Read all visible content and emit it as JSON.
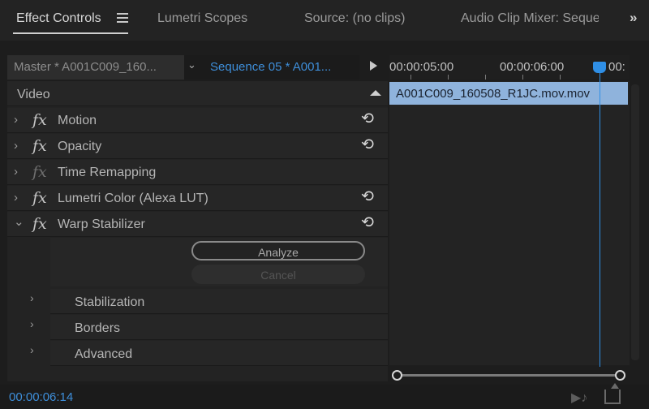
{
  "tabs": {
    "effect_controls": "Effect Controls",
    "lumetri_scopes": "Lumetri Scopes",
    "source": "Source: (no clips)",
    "audio_clip_mixer": "Audio Clip Mixer: Seque",
    "overflow": "»"
  },
  "header": {
    "master_clip": "Master * A001C009_160...",
    "sequence_clip": "Sequence 05 * A001..."
  },
  "effects": {
    "section_label": "Video",
    "fx_symbol": "fx",
    "reset_glyph": "⟲",
    "items": [
      {
        "label": "Motion",
        "twirl": "›",
        "expanded": false
      },
      {
        "label": "Opacity",
        "twirl": "›",
        "expanded": false
      },
      {
        "label": "Time Remapping",
        "twirl": "›",
        "expanded": false
      },
      {
        "label": "Lumetri Color (Alexa LUT)",
        "twirl": "›",
        "expanded": false
      },
      {
        "label": "Warp Stabilizer",
        "twirl": "⌄",
        "expanded": true
      }
    ],
    "warp": {
      "analyze_label": "Analyze",
      "cancel_label": "Cancel",
      "subgroups": [
        "Stabilization",
        "Borders",
        "Advanced"
      ]
    }
  },
  "timeline": {
    "ruler_labels": [
      "00:00:05:00",
      "00:00:06:00",
      "00:"
    ],
    "clip_name": "A001C009_160508_R1JC.mov.mov"
  },
  "footer": {
    "timecode": "00:00:06:14"
  },
  "colors": {
    "accent_blue": "#3e8ed9",
    "clip_fill": "#8fb3dc",
    "playhead": "#2f8fe6"
  }
}
